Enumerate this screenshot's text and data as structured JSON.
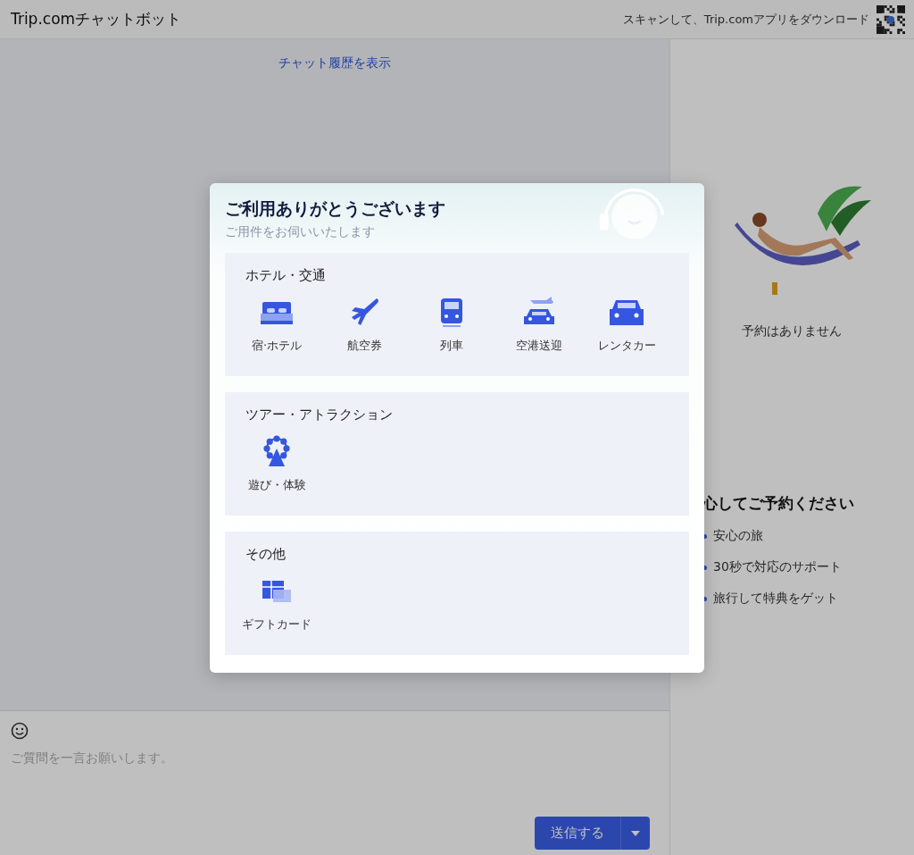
{
  "header": {
    "title": "Trip.comチャットボット",
    "download_text": "スキャンして、Trip.comアプリをダウンロード"
  },
  "chat": {
    "history_link": "チャット履歴を表示"
  },
  "composer": {
    "placeholder": "ご質問を一言お願いします。",
    "send_button": "送信する"
  },
  "sidebar": {
    "empty_text": "予約はありません",
    "heading": "心してご予約ください",
    "points": [
      "安心の旅",
      "30秒で対応のサポート",
      "旅行して特典をゲット"
    ]
  },
  "modal": {
    "title": "ご利用ありがとうございます",
    "subtitle": "ご用件をお伺いいたします",
    "sections": [
      {
        "title": "ホテル・交通",
        "items": [
          {
            "kind": "hotel",
            "label": "宿·ホテル"
          },
          {
            "kind": "flight",
            "label": "航空券"
          },
          {
            "kind": "train",
            "label": "列車"
          },
          {
            "kind": "transfer",
            "label": "空港送迎"
          },
          {
            "kind": "car",
            "label": "レンタカー"
          }
        ]
      },
      {
        "title": "ツアー・アトラクション",
        "items": [
          {
            "kind": "attraction",
            "label": "遊び・体験"
          }
        ]
      },
      {
        "title": "その他",
        "items": [
          {
            "kind": "gift",
            "label": "ギフトカード"
          }
        ]
      }
    ]
  }
}
